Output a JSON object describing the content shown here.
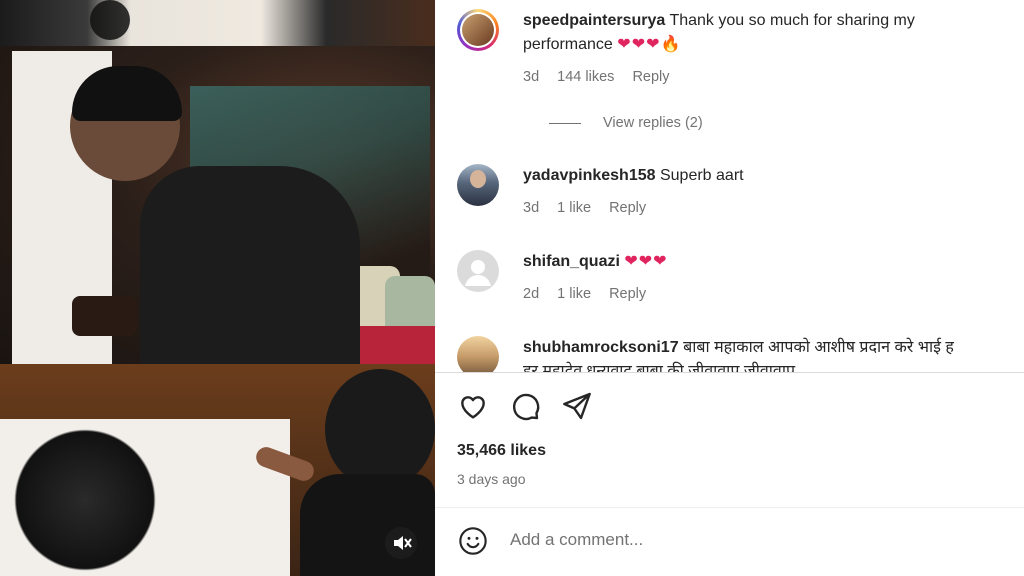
{
  "comments": [
    {
      "username": "speedpaintersurya",
      "text": "Thank you so much for sharing my",
      "text_line2": "performance",
      "emoji": "❤❤❤🔥",
      "time": "3d",
      "likes": "144 likes",
      "reply": "Reply",
      "view_replies": "View replies (2)"
    },
    {
      "username": "yadavpinkesh158",
      "text": "Superb aart",
      "time": "3d",
      "likes": "1 like",
      "reply": "Reply"
    },
    {
      "username": "shifan_quazi",
      "emoji": "❤❤❤",
      "time": "2d",
      "likes": "1 like",
      "reply": "Reply"
    },
    {
      "username": "shubhamrocksoni17",
      "text": "बाबा महाकाल आपको आशीष प्रदान करे भाई ह",
      "text_line2": "हर महादेव धन्यवाद बाबा की जीवावाप जीवावाप"
    }
  ],
  "actions": {
    "like_icon": "heart-icon",
    "comment_icon": "comment-icon",
    "share_icon": "share-icon"
  },
  "post": {
    "likes": "35,466 likes",
    "posted": "3 days ago"
  },
  "add_comment": {
    "placeholder": "Add a comment...",
    "icon": "emoji-icon"
  },
  "media": {
    "mute_icon": "mute-icon"
  }
}
